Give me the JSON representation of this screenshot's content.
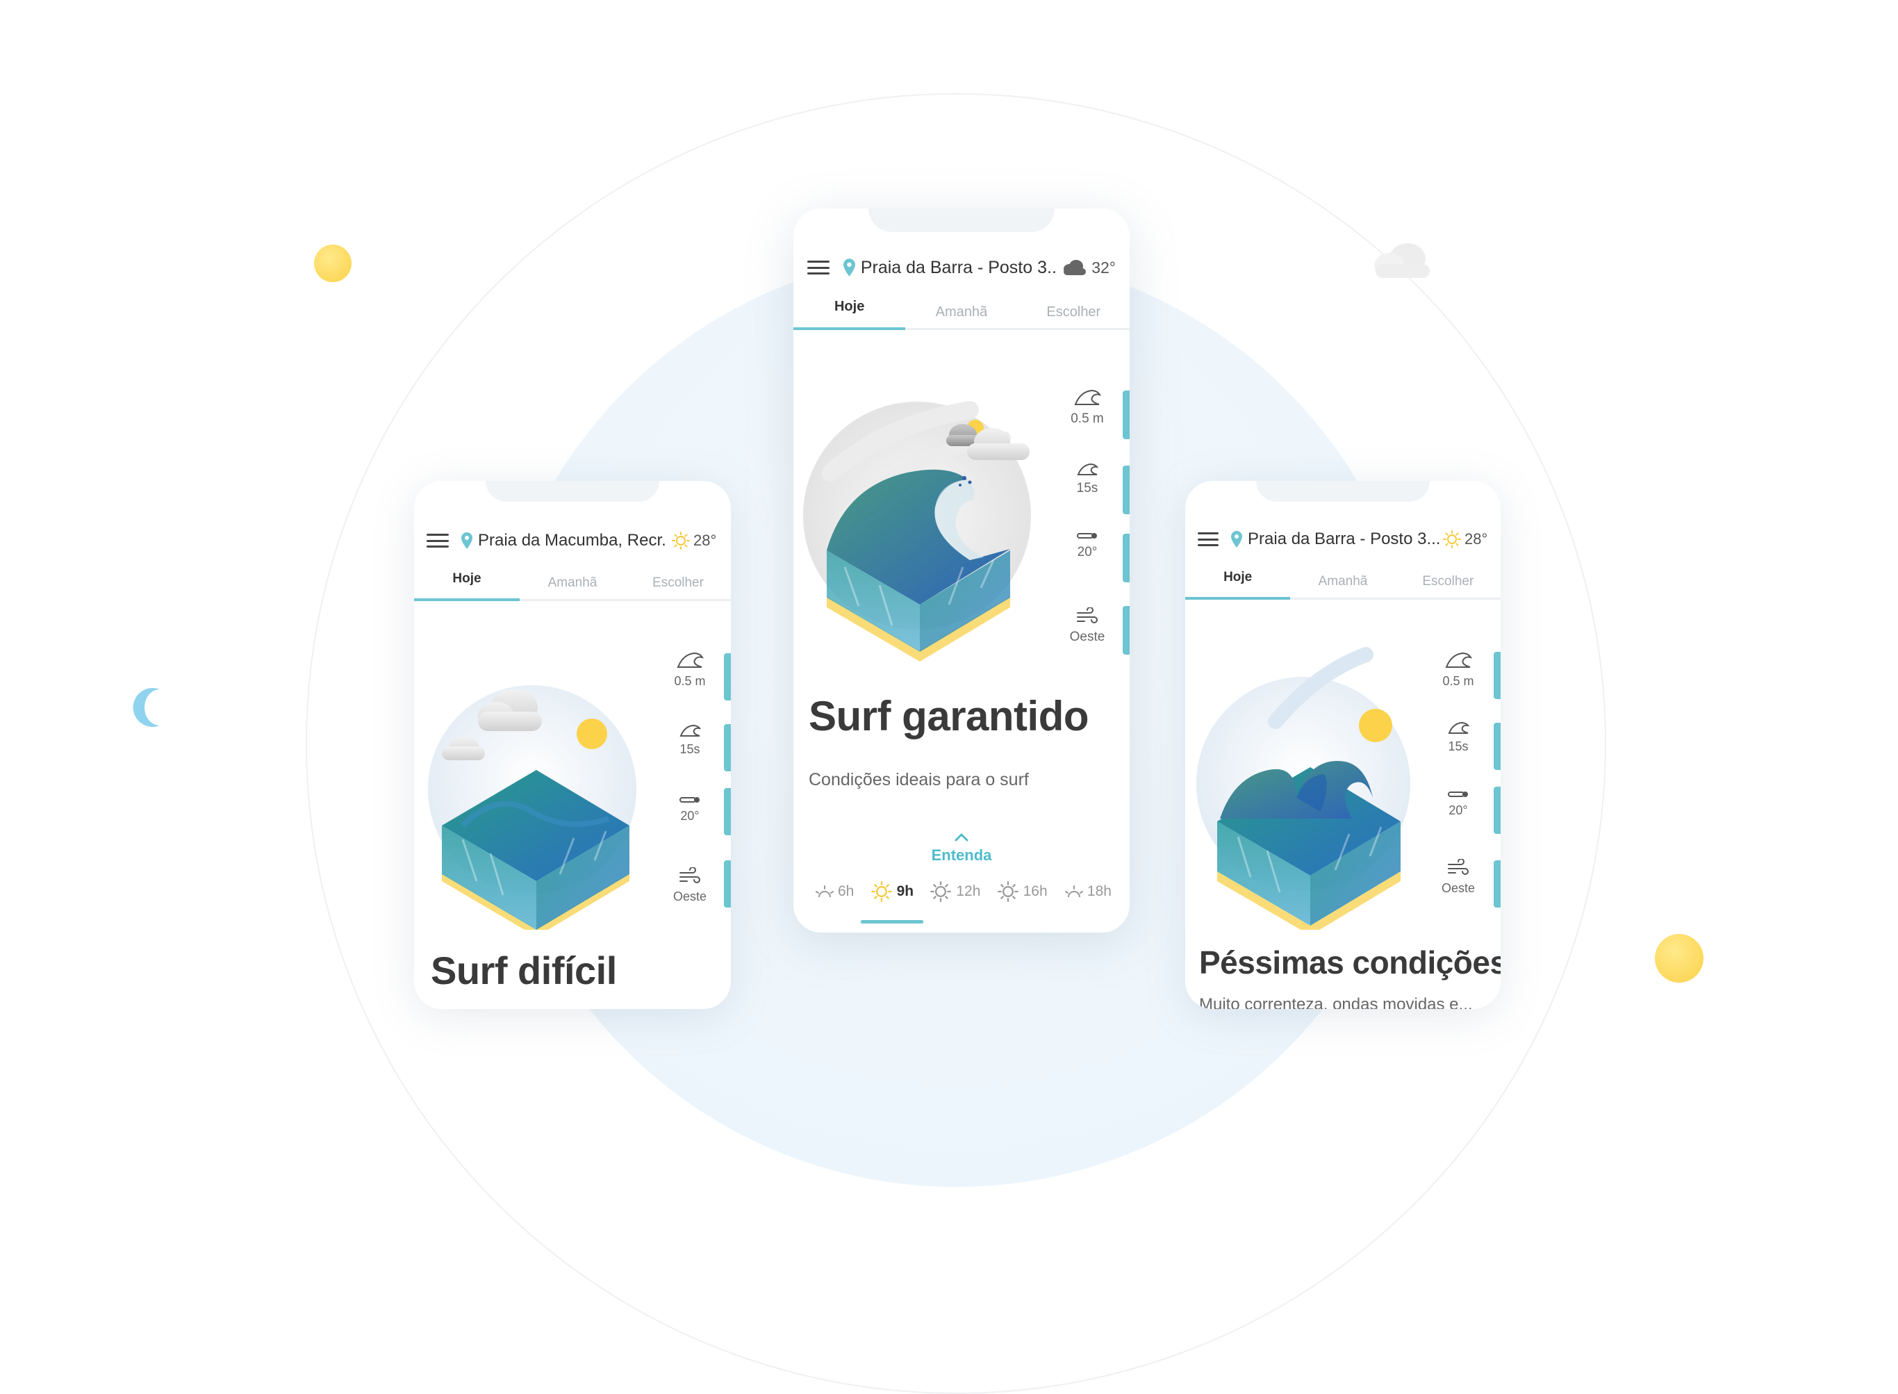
{
  "colors": {
    "accent": "#6cc5d1",
    "sun": "#fbd24a",
    "text": "#333333"
  },
  "phones": {
    "left": {
      "location": "Praia da Macumba, Recr...",
      "weather_icon": "sun-icon",
      "temperature": "28°",
      "tabs": [
        {
          "label": "Hoje",
          "active": true
        },
        {
          "label": "Amanhã",
          "active": false
        },
        {
          "label": "Escolher",
          "active": false
        }
      ],
      "stats": {
        "wave_height": "0.5 m",
        "period": "15s",
        "water_temp": "20°",
        "wind": "Oeste"
      },
      "title": "Surf difícil"
    },
    "center": {
      "location": "Praia da Barra - Posto 3...",
      "weather_icon": "cloud-icon",
      "temperature": "32°",
      "tabs": [
        {
          "label": "Hoje",
          "active": true
        },
        {
          "label": "Amanhã",
          "active": false
        },
        {
          "label": "Escolher",
          "active": false
        }
      ],
      "stats": {
        "wave_height": "0.5 m",
        "period": "15s",
        "water_temp": "20°",
        "wind": "Oeste"
      },
      "title": "Surf garantido",
      "subtitle": "Condições ideais para o surf",
      "entenda": "Entenda",
      "hours": [
        {
          "label": "6h",
          "icon": "sunrise-icon",
          "active": false
        },
        {
          "label": "9h",
          "icon": "sun-icon",
          "active": true
        },
        {
          "label": "12h",
          "icon": "sun-icon",
          "active": false
        },
        {
          "label": "16h",
          "icon": "sun-icon",
          "active": false
        },
        {
          "label": "18h",
          "icon": "sunset-icon",
          "active": false
        }
      ]
    },
    "right": {
      "location": "Praia da Barra - Posto 3...",
      "weather_icon": "sun-icon",
      "temperature": "28°",
      "tabs": [
        {
          "label": "Hoje",
          "active": true
        },
        {
          "label": "Amanhã",
          "active": false
        },
        {
          "label": "Escolher",
          "active": false
        }
      ],
      "stats": {
        "wave_height": "0.5 m",
        "period": "15s",
        "water_temp": "20°",
        "wind": "Oeste"
      },
      "title": "Péssimas condições",
      "subtitle": "Muito correnteza, ondas movidas e..."
    }
  }
}
